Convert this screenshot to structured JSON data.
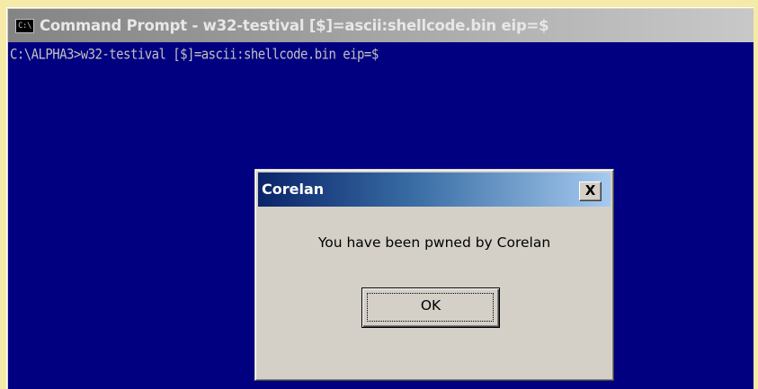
{
  "window": {
    "icon_text": "C:\\",
    "title": "Command Prompt - w32-testival [$]=ascii:shellcode.bin eip=$"
  },
  "console": {
    "lines": [
      "C:\\ALPHA3>w32-testival [$]=ascii:shellcode.bin eip=$"
    ]
  },
  "dialog": {
    "title": "Corelan",
    "close_label": "X",
    "message": "You have been pwned by Corelan",
    "ok_label": "OK"
  },
  "colors": {
    "console_background": "#000080",
    "console_text": "#c0c0c0",
    "page_background": "#f6eaa8",
    "dialog_face": "#d4d0c8",
    "dialog_titlebar": "#0a246a"
  }
}
